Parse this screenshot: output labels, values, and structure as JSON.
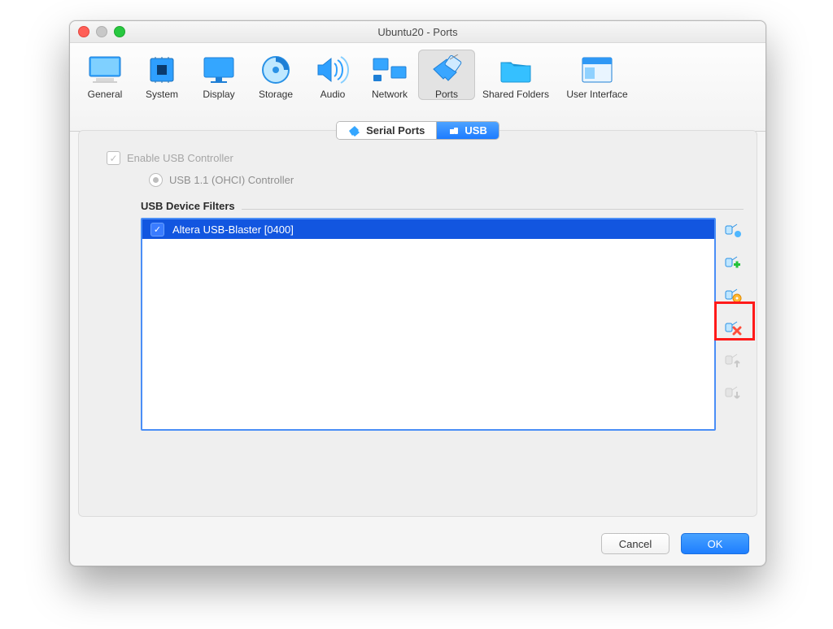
{
  "window": {
    "title": "Ubuntu20 - Ports"
  },
  "toolbar": [
    "General",
    "System",
    "Display",
    "Storage",
    "Audio",
    "Network",
    "Ports",
    "Shared Folders",
    "User Interface"
  ],
  "toolbar_selected": "Ports",
  "tabs": {
    "serial": "Serial Ports",
    "usb": "USB",
    "active": "USB"
  },
  "usb": {
    "enable_label": "Enable USB Controller",
    "enable_checked": true,
    "controller_options": [
      "USB 1.1 (OHCI) Controller"
    ],
    "controller_selected": "USB 1.1 (OHCI) Controller",
    "filters_label": "USB Device Filters",
    "filters": [
      {
        "label": "Altera USB-Blaster [0400]",
        "checked": true,
        "selected": true
      }
    ],
    "side_actions": [
      "add-empty-filter",
      "add-filter-from-device",
      "edit-filter",
      "remove-filter",
      "move-filter-up",
      "move-filter-down"
    ],
    "side_actions_disabled": [
      "move-filter-up",
      "move-filter-down"
    ]
  },
  "footer": {
    "cancel": "Cancel",
    "ok": "OK"
  },
  "annotation": {
    "highlighted_action": "add-filter-from-device"
  },
  "colors": {
    "accent": "#1d7bff",
    "selection": "#1256e0",
    "highlight_border": "#ff1a1a"
  }
}
